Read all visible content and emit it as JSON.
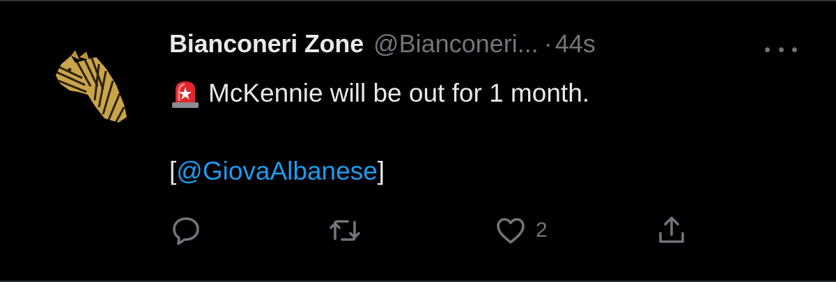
{
  "tweet": {
    "display_name": "Bianconeri Zone",
    "handle": "@Bianconeri...",
    "separator": "·",
    "timestamp": "44s",
    "avatar_icon": "zebra-head-icon",
    "text_emoji": "rotating-light-icon",
    "text_line1": "McKennie will be out for 1 month.",
    "bracket_open": "[",
    "mention": "@GiovaAlbanese",
    "bracket_close": "]"
  },
  "actions": {
    "reply_icon": "reply-icon",
    "retweet_icon": "retweet-icon",
    "like_icon": "heart-icon",
    "like_count": "2",
    "share_icon": "share-icon"
  },
  "colors": {
    "background": "#000000",
    "text": "#e7e9ea",
    "muted": "#71767b",
    "link": "#1d9bf0"
  }
}
